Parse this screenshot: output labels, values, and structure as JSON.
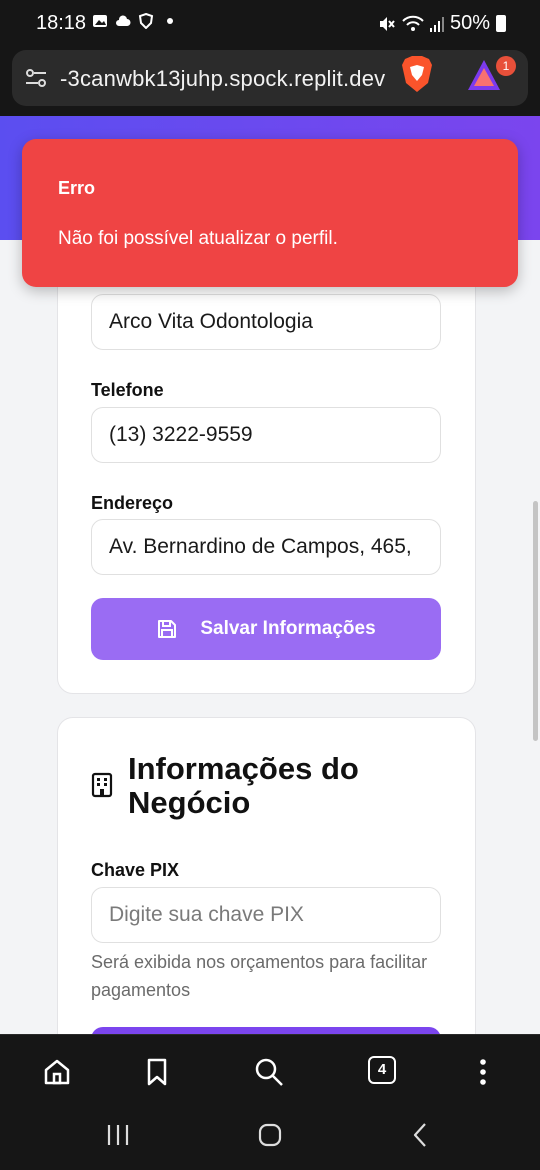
{
  "status_bar": {
    "time": "18:18",
    "battery": "50%",
    "icons": [
      "gallery-icon",
      "cloud-icon",
      "shield-app-icon",
      "mute-icon",
      "wifi-icon",
      "signal-icon",
      "battery-icon"
    ]
  },
  "browser": {
    "url": "-3canwbk13juhp.spock.replit.dev",
    "rewards_badge": "1",
    "tab_count": "4",
    "bottom_icons": [
      "home-icon",
      "bookmark-icon",
      "search-icon",
      "tabs-icon",
      "more-icon"
    ]
  },
  "form": {
    "company_value": "Arco Vita Odontologia",
    "phone_label": "Telefone",
    "phone_value": "(13) 3222-9559",
    "address_label": "Endereço",
    "address_value": "Av. Bernardino de Campos, 465,",
    "save_button": "Salvar Informações"
  },
  "business": {
    "title": "Informações do Negócio",
    "pix_label": "Chave PIX",
    "pix_placeholder": "Digite sua chave PIX",
    "pix_help": "Será exibida nos orçamentos para facilitar pagamentos"
  },
  "toast": {
    "title": "Erro",
    "message": "Não foi possível atualizar o perfil."
  },
  "colors": {
    "header_gradient_start": "#5b4ef0",
    "header_gradient_end": "#7b45ee",
    "primary_button": "#9a6cf3",
    "toast_bg": "#ef4444"
  }
}
